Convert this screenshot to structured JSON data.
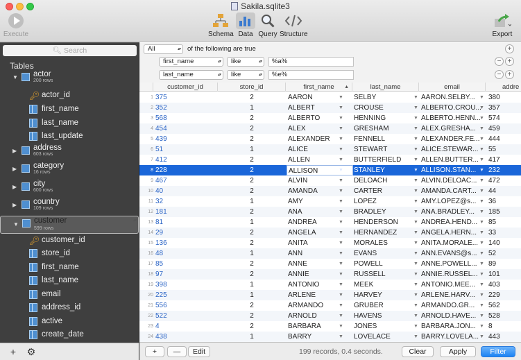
{
  "window": {
    "title": "Sakila.sqlite3"
  },
  "toolbar": {
    "execute": "Execute",
    "schema": "Schema",
    "data": "Data",
    "query": "Query",
    "structure": "Structure",
    "export": "Export"
  },
  "sidebar": {
    "search_placeholder": "Search",
    "header": "Tables",
    "tables": [
      {
        "name": "actor",
        "rows": "200 rows",
        "expanded": true,
        "columns": [
          "actor_id",
          "first_name",
          "last_name",
          "last_update"
        ]
      },
      {
        "name": "address",
        "rows": "603 rows"
      },
      {
        "name": "category",
        "rows": "16 rows"
      },
      {
        "name": "city",
        "rows": "600 rows"
      },
      {
        "name": "country",
        "rows": "109 rows"
      },
      {
        "name": "customer",
        "rows": "599 rows",
        "expanded": true,
        "selected": true,
        "columns": [
          "customer_id",
          "store_id",
          "first_name",
          "last_name",
          "email",
          "address_id",
          "active",
          "create_date"
        ]
      }
    ],
    "footer": {
      "add": "+",
      "settings": "⚙"
    }
  },
  "filter": {
    "match_mode": "All",
    "match_text": "of the following are true",
    "rules": [
      {
        "field": "first_name",
        "op": "like",
        "value": "%a%"
      },
      {
        "field": "last_name",
        "op": "like",
        "value": "%e%"
      }
    ],
    "plus": "+",
    "minus": "−"
  },
  "grid": {
    "columns": [
      "customer_id",
      "store_id",
      "first_name",
      "last_name",
      "email",
      "addre"
    ],
    "selected_row": 8,
    "rows": [
      [
        "1",
        "375",
        "2",
        "AARON",
        "SELBY",
        "AARON.SELBY...",
        "380"
      ],
      [
        "2",
        "352",
        "1",
        "ALBERT",
        "CROUSE",
        "ALBERTO.CROU...",
        "357"
      ],
      [
        "3",
        "568",
        "2",
        "ALBERTO",
        "HENNING",
        "ALBERTO.HENN...",
        "574"
      ],
      [
        "4",
        "454",
        "2",
        "ALEX",
        "GRESHAM",
        "ALEX.GRESHA...",
        "459"
      ],
      [
        "5",
        "439",
        "2",
        "ALEXANDER",
        "FENNELL",
        "ALEXANDER.FE...",
        "444"
      ],
      [
        "6",
        "51",
        "1",
        "ALICE",
        "STEWART",
        "ALICE.STEWAR...",
        "55"
      ],
      [
        "7",
        "412",
        "2",
        "ALLEN",
        "BUTTERFIELD",
        "ALLEN.BUTTER...",
        "417"
      ],
      [
        "8",
        "228",
        "2",
        "ALLISON",
        "STANLEY",
        "ALLISON.STAN...",
        "232"
      ],
      [
        "9",
        "467",
        "2",
        "ALVIN",
        "DELOACH",
        "ALVIN.DELOAC...",
        "472"
      ],
      [
        "10",
        "40",
        "2",
        "AMANDA",
        "CARTER",
        "AMANDA.CART...",
        "44"
      ],
      [
        "11",
        "32",
        "1",
        "AMY",
        "LOPEZ",
        "AMY.LOPEZ@s...",
        "36"
      ],
      [
        "12",
        "181",
        "2",
        "ANA",
        "BRADLEY",
        "ANA.BRADLEY...",
        "185"
      ],
      [
        "13",
        "81",
        "1",
        "ANDREA",
        "HENDERSON",
        "ANDREA.HEND...",
        "85"
      ],
      [
        "14",
        "29",
        "2",
        "ANGELA",
        "HERNANDEZ",
        "ANGELA.HERN...",
        "33"
      ],
      [
        "15",
        "136",
        "2",
        "ANITA",
        "MORALES",
        "ANITA.MORALE...",
        "140"
      ],
      [
        "16",
        "48",
        "1",
        "ANN",
        "EVANS",
        "ANN.EVANS@s...",
        "52"
      ],
      [
        "17",
        "85",
        "2",
        "ANNE",
        "POWELL",
        "ANNE.POWELL...",
        "89"
      ],
      [
        "18",
        "97",
        "2",
        "ANNIE",
        "RUSSELL",
        "ANNIE.RUSSEL...",
        "101"
      ],
      [
        "19",
        "398",
        "1",
        "ANTONIO",
        "MEEK",
        "ANTONIO.MEE...",
        "403"
      ],
      [
        "20",
        "225",
        "1",
        "ARLENE",
        "HARVEY",
        "ARLENE.HARV...",
        "229"
      ],
      [
        "21",
        "556",
        "2",
        "ARMANDO",
        "GRUBER",
        "ARMANDO.GR...",
        "562"
      ],
      [
        "22",
        "522",
        "2",
        "ARNOLD",
        "HAVENS",
        "ARNOLD.HAVE...",
        "528"
      ],
      [
        "23",
        "4",
        "2",
        "BARBARA",
        "JONES",
        "BARBARA.JON...",
        "8"
      ],
      [
        "24",
        "438",
        "1",
        "BARRY",
        "LOVELACE",
        "BARRY.LOVELA...",
        "443"
      ]
    ]
  },
  "bottom": {
    "add": "+",
    "remove": "—",
    "edit": "Edit",
    "status": "199 records, 0.4 seconds.",
    "clear": "Clear",
    "apply": "Apply",
    "filter": "Filter"
  },
  "colors": {
    "selection": "#1a66d9",
    "id_link": "#2a64c6",
    "sidebar_bg": "#3f3f3f"
  }
}
